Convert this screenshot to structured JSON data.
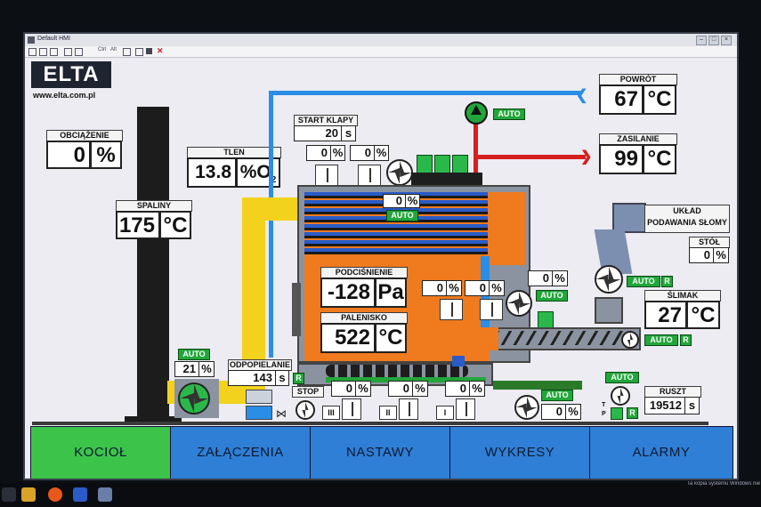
{
  "window": {
    "title": "Default HMI"
  },
  "toolbar": {
    "ctrl_label": "Ctrl",
    "alt_label": "Alt"
  },
  "logo": {
    "brand": "ELTA",
    "url": "www.elta.com.pl"
  },
  "obciazenie": {
    "label": "OBCIĄŻENIE",
    "value": "0",
    "unit": "%"
  },
  "tlen": {
    "label": "TLEN",
    "value": "13.8",
    "unit": "%O",
    "unit_sub": "2"
  },
  "spaliny": {
    "label": "SPALINY",
    "value": "175",
    "unit": "°C"
  },
  "start_klapy": {
    "label": "START KLAPY",
    "value": "20",
    "unit": "s"
  },
  "damper_pct_1": {
    "value": "0",
    "unit": "%"
  },
  "damper_pct_2": {
    "value": "0",
    "unit": "%"
  },
  "powrot": {
    "label": "POWRÓT",
    "value": "67",
    "unit": "°C"
  },
  "zasilanie": {
    "label": "ZASILANIE",
    "value": "99",
    "unit": "°C"
  },
  "pump_auto": "AUTO",
  "boiler_pct": {
    "value": "0",
    "unit": "%",
    "auto": "AUTO"
  },
  "uklad": {
    "line1": "UKŁAD",
    "line2": "PODAWANIA SŁOMY"
  },
  "stol": {
    "label": "STÓŁ",
    "value": "0",
    "unit": "%"
  },
  "podcisnienie": {
    "label": "PODCIŚNIENIE",
    "value": "-128",
    "unit": "Pa"
  },
  "palenisko": {
    "label": "PALENISKO",
    "value": "522",
    "unit": "°C"
  },
  "air_pct_1": {
    "value": "0",
    "unit": "%"
  },
  "air_pct_2": {
    "value": "0",
    "unit": "%"
  },
  "fan2_pct": {
    "value": "0",
    "unit": "%",
    "auto": "AUTO"
  },
  "slimak": {
    "label": "ŚLIMAK",
    "value": "27",
    "unit": "°C",
    "auto": "AUTO",
    "r": "R"
  },
  "feeder_auto": {
    "auto": "AUTO",
    "r": "R"
  },
  "main_fan": {
    "auto": "AUTO",
    "value": "21",
    "unit": "%"
  },
  "odpopielanie": {
    "label": "ODPOPIELANIE",
    "value": "143",
    "unit": "s",
    "r": "R",
    "stop": "STOP"
  },
  "grate_zones": [
    {
      "roman": "III",
      "value": "0",
      "unit": "%"
    },
    {
      "roman": "II",
      "value": "0",
      "unit": "%"
    },
    {
      "roman": "I",
      "value": "0",
      "unit": "%"
    }
  ],
  "ruszt": {
    "label": "RUSZT",
    "value": "19512",
    "unit": "s",
    "auto": "AUTO",
    "r": "R",
    "t": "T",
    "p": "P"
  },
  "bottom_fan": {
    "auto": "AUTO",
    "value": "0",
    "unit": "%"
  },
  "nav": [
    {
      "label": "KOCIOŁ",
      "active": true
    },
    {
      "label": "ZAŁĄCZENIA",
      "active": false
    },
    {
      "label": "NASTAWY",
      "active": false
    },
    {
      "label": "WYKRESY",
      "active": false
    },
    {
      "label": "ALARMY",
      "active": false
    }
  ],
  "os": {
    "notice": "Ta kopia systemu Windows nie"
  },
  "colors": {
    "orange": "#f07a1e",
    "blue_pipe": "#2a8ee6",
    "red_pipe": "#d61f1f",
    "yellow_duct": "#f2d21c",
    "green": "#22a63a",
    "nav_active": "#3cc44a",
    "nav": "#2f7fd6"
  }
}
